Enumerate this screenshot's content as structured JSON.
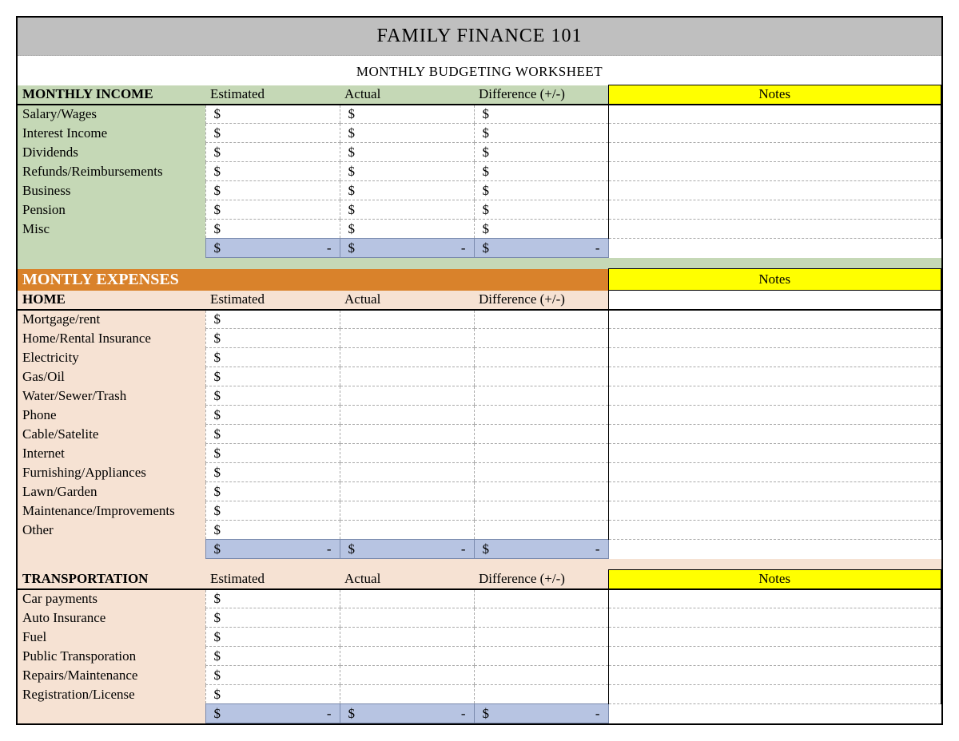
{
  "title": "FAMILY FINANCE 101",
  "subtitle": "MONTHLY BUDGETING WORKSHEET",
  "columns": {
    "estimated": "Estimated",
    "actual": "Actual",
    "difference": "Difference (+/-)",
    "notes": "Notes"
  },
  "dollar": "$",
  "dash": "-",
  "income": {
    "header": "MONTHLY INCOME",
    "rows": [
      {
        "label": "Salary/Wages"
      },
      {
        "label": "Interest Income"
      },
      {
        "label": "Dividends"
      },
      {
        "label": "Refunds/Reimbursements"
      },
      {
        "label": "Business"
      },
      {
        "label": "Pension"
      },
      {
        "label": "Misc"
      }
    ]
  },
  "expenses": {
    "header": "MONTLY EXPENSES",
    "sections": [
      {
        "title": "HOME",
        "rows": [
          {
            "label": "Mortgage/rent"
          },
          {
            "label": "Home/Rental Insurance"
          },
          {
            "label": "Electricity"
          },
          {
            "label": "Gas/Oil"
          },
          {
            "label": "Water/Sewer/Trash"
          },
          {
            "label": "Phone"
          },
          {
            "label": "Cable/Satelite"
          },
          {
            "label": "Internet"
          },
          {
            "label": "Furnishing/Appliances"
          },
          {
            "label": "Lawn/Garden"
          },
          {
            "label": "Maintenance/Improvements"
          },
          {
            "label": "Other"
          }
        ]
      },
      {
        "title": "TRANSPORTATION",
        "rows": [
          {
            "label": "Car payments"
          },
          {
            "label": "Auto Insurance"
          },
          {
            "label": "Fuel"
          },
          {
            "label": "Public Transporation"
          },
          {
            "label": "Repairs/Maintenance"
          },
          {
            "label": "Registration/License"
          }
        ]
      }
    ]
  }
}
